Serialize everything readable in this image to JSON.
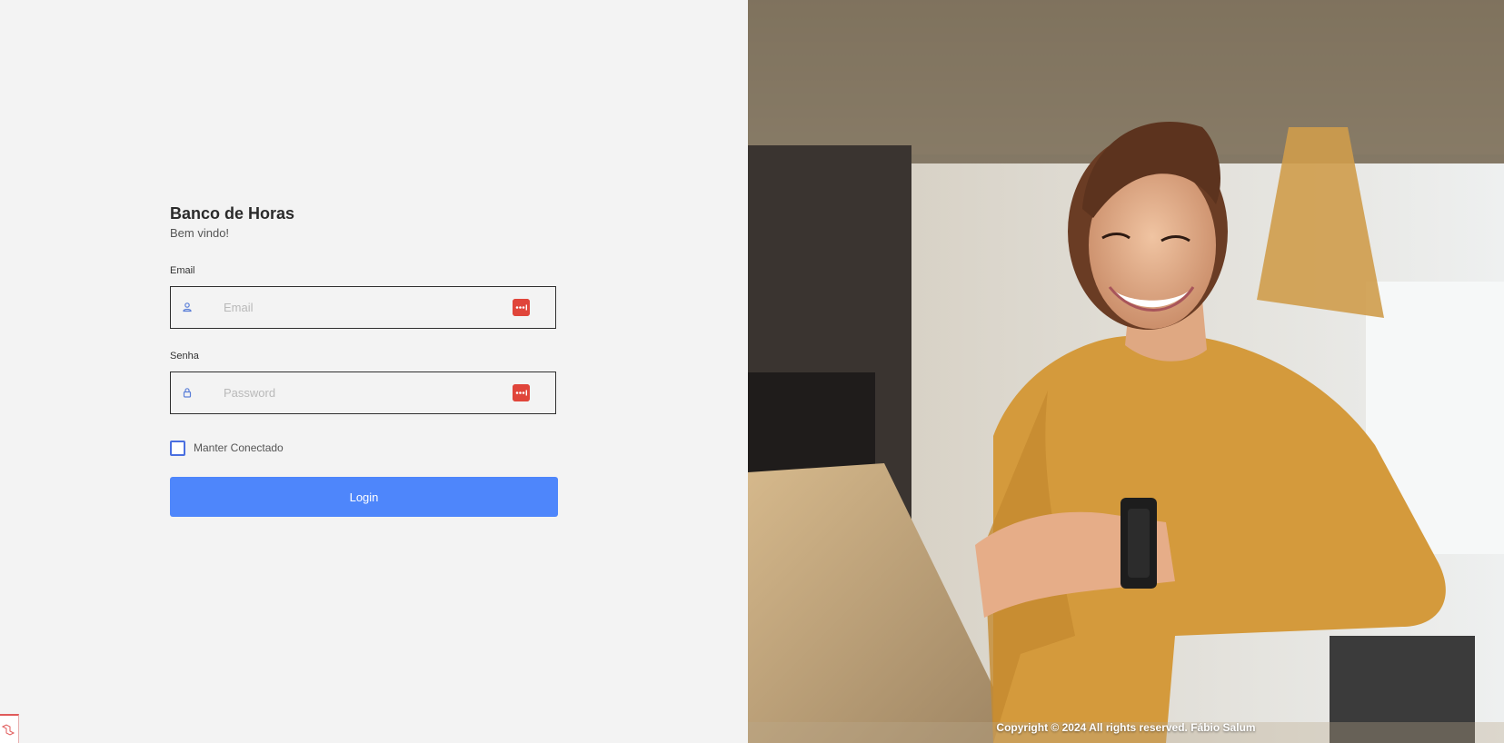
{
  "app": {
    "title": "Banco de Horas",
    "subtitle": "Bem vindo!"
  },
  "form": {
    "email": {
      "label": "Email",
      "placeholder": "Email",
      "value": "",
      "icon": "user-icon"
    },
    "password": {
      "label": "Senha",
      "placeholder": "Password",
      "value": "",
      "icon": "lock-icon"
    },
    "password_manager_icon": "password-manager-icon",
    "remember": {
      "label": "Manter Conectado",
      "checked": false
    },
    "submit_label": "Login"
  },
  "footer": {
    "copyright": "Copyright © 2024 All rights reserved. Fábio Salum"
  },
  "hero": {
    "image": "hero-photo"
  },
  "colors": {
    "accent": "#4e86fb",
    "page_background": "#f3f3f3",
    "password_manager": "#e0453a",
    "checkbox_border": "#4a6fe0"
  }
}
